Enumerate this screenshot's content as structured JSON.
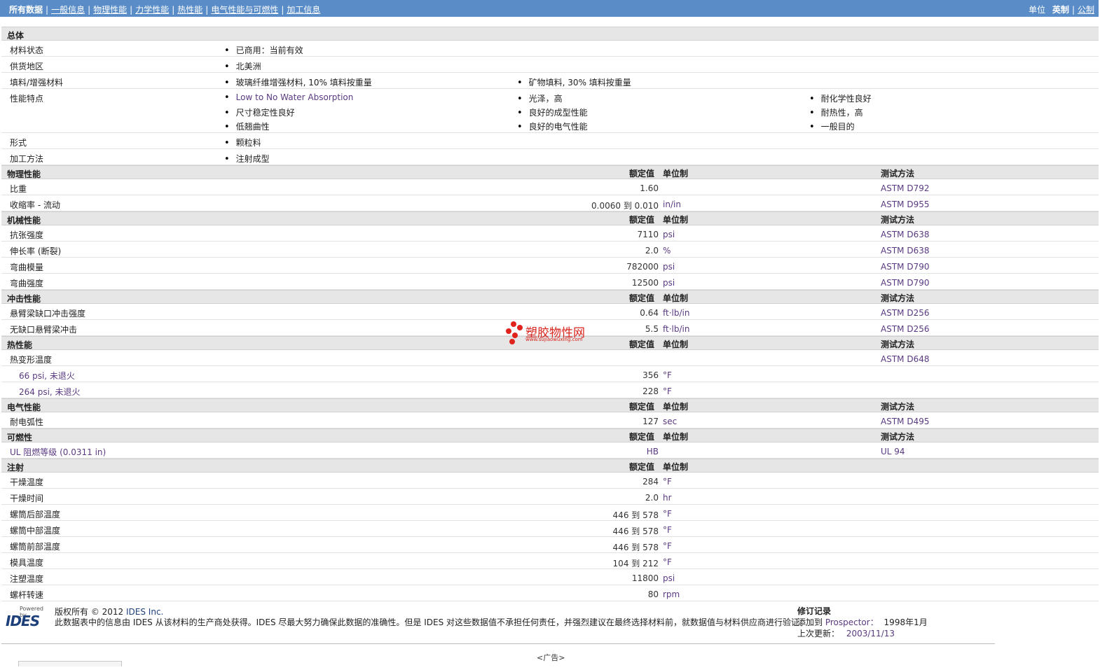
{
  "nav": {
    "items": [
      "所有数据",
      "一般信息",
      "物理性能",
      "力学性能",
      "热性能",
      "电气性能与可燃性",
      "加工信息"
    ],
    "units_label": "单位",
    "units_imperial": "英制",
    "units_metric": "公制"
  },
  "general": {
    "title": "总体",
    "material_status_label": "材料状态",
    "material_status": "已商用：当前有效",
    "region_label": "供货地区",
    "region": "北美洲",
    "filler_label": "填料/增强材料",
    "filler_1": "玻璃纤维增强材料, 10% 填料按重量",
    "filler_2": "矿物填料, 30% 填料按重量",
    "features_label": "性能特点",
    "features": [
      "Low to No Water Absorption",
      "光泽，高",
      "耐化学性良好",
      "尺寸稳定性良好",
      "良好的成型性能",
      "耐热性，高",
      "低翘曲性",
      "良好的电气性能",
      "一般目的"
    ],
    "form_label": "形式",
    "form": "颗粒料",
    "process_label": "加工方法",
    "process": "注射成型"
  },
  "headers": {
    "value": "额定值",
    "unit": "单位制",
    "method": "测试方法"
  },
  "physical": {
    "title": "物理性能",
    "rows": [
      {
        "label": "比重",
        "value": "1.60",
        "unit": "",
        "method": "ASTM D792"
      },
      {
        "label": "收缩率 - 流动",
        "value": "0.0060 到  0.010",
        "unit": "in/in",
        "method": "ASTM D955"
      }
    ]
  },
  "mechanical": {
    "title": "机械性能",
    "rows": [
      {
        "label": "抗张强度",
        "value": "7110",
        "unit": "psi",
        "method": "ASTM D638"
      },
      {
        "label": "伸长率 (断裂)",
        "value": "2.0",
        "unit": "%",
        "method": "ASTM D638"
      },
      {
        "label": "弯曲模量",
        "value": "782000",
        "unit": "psi",
        "method": "ASTM D790"
      },
      {
        "label": "弯曲强度",
        "value": "12500",
        "unit": "psi",
        "method": "ASTM D790"
      }
    ]
  },
  "impact": {
    "title": "冲击性能",
    "rows": [
      {
        "label": "悬臂梁缺口冲击强度",
        "value": "0.64",
        "unit": "ft·lb/in",
        "method": "ASTM D256"
      },
      {
        "label": "无缺口悬臂梁冲击",
        "value": "5.5",
        "unit": "ft·lb/in",
        "method": "ASTM D256"
      }
    ]
  },
  "thermal": {
    "title": "热性能",
    "hdt_label": "热变形温度",
    "hdt_method": "ASTM D648",
    "rows": [
      {
        "label": "66 psi, 未退火",
        "value": "356",
        "unit": "°F"
      },
      {
        "label": "264 psi, 未退火",
        "value": "228",
        "unit": "°F"
      }
    ]
  },
  "electrical": {
    "title": "电气性能",
    "rows": [
      {
        "label": "耐电弧性",
        "value": "127",
        "unit": "sec",
        "method": "ASTM D495"
      }
    ]
  },
  "flammability": {
    "title": "可燃性",
    "rows": [
      {
        "label": "UL 阻燃等级 (0.0311 in)",
        "value": "HB",
        "unit": "",
        "method": "UL 94"
      }
    ]
  },
  "injection": {
    "title": "注射",
    "rows": [
      {
        "label": "干燥温度",
        "value": "284",
        "unit": "°F"
      },
      {
        "label": "干燥时间",
        "value": "2.0",
        "unit": "hr"
      },
      {
        "label": "螺筒后部温度",
        "value": "446 到  578",
        "unit": "°F"
      },
      {
        "label": "螺筒中部温度",
        "value": "446 到  578",
        "unit": "°F"
      },
      {
        "label": "螺筒前部温度",
        "value": "446 到  578",
        "unit": "°F"
      },
      {
        "label": "模具温度",
        "value": "104 到  212",
        "unit": "°F"
      },
      {
        "label": "注塑温度",
        "value": "11800",
        "unit": "psi"
      },
      {
        "label": "螺杆转速",
        "value": "80",
        "unit": "rpm"
      }
    ]
  },
  "footer": {
    "powered_by": "Powered by",
    "logo_text": "IDES",
    "copyright": "版权所有 © 2012",
    "company": "IDES Inc.",
    "disclaimer": "此数据表中的信息由 IDES 从该材料的生产商处获得。IDES 尽最大努力确保此数据的准确性。但是 IDES 对这些数据值不承担任何责任，并强烈建议在最终选择材料前，就数据值与材料供应商进行验证。",
    "revision_title": "修订记录",
    "added_label": "添加到",
    "added_source": "Prospector：",
    "added_date": "1998年1月",
    "updated_label": "上次更新：",
    "updated_date": "2003/11/13"
  },
  "ad": "<广告>",
  "watermark": {
    "text": "塑胶物性网",
    "url": "www.sujiaowuxing.com"
  }
}
